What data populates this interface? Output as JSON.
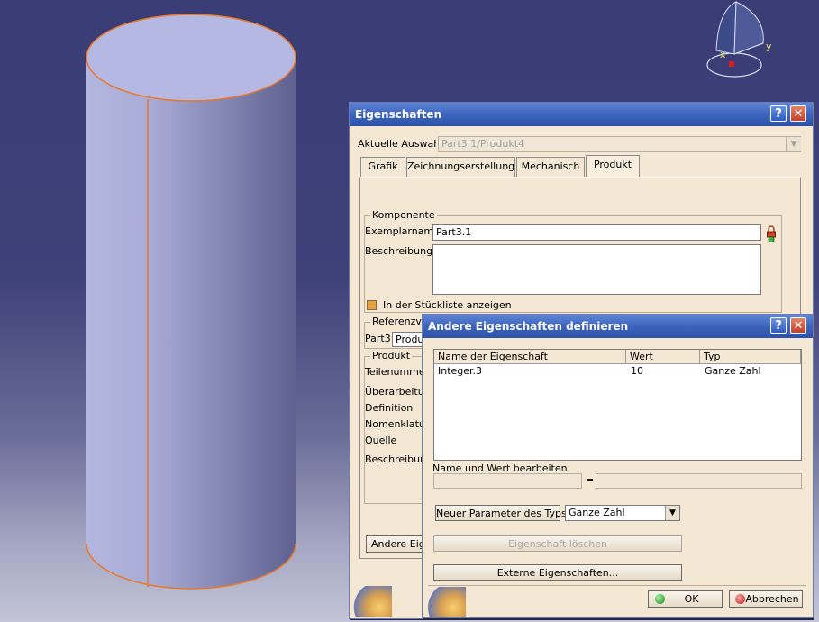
{
  "compass": {
    "y_label": "y",
    "x_label": "x"
  },
  "props": {
    "title": "Eigenschaften",
    "current_label": "Aktuelle Auswahl:",
    "current_value": "Part3.1/Produkt4",
    "tabs": [
      "Grafik",
      "Zeichnungserstellung",
      "Mechanisch",
      "Produkt"
    ],
    "active_tab": "Produkt",
    "komponente": {
      "title": "Komponente",
      "instance_label": "Exemplarname",
      "instance_value": "Part3.1",
      "desc_label": "Beschreibung",
      "bom_label": "In der Stückliste anzeigen"
    },
    "referenz": {
      "title": "Referenzve",
      "row_label": "Part3",
      "row_value": "Produ"
    },
    "produkt": {
      "title": "Produkt",
      "rows": [
        "Teilenummer",
        "Überarbeitun",
        "Definition",
        "Nomenklatur",
        "Quelle",
        "Beschreibung"
      ]
    },
    "other_btn": "Andere Eige"
  },
  "define": {
    "title": "Andere Eigenschaften definieren",
    "columns": [
      "Name der Eigenschaft",
      "Wert",
      "Typ"
    ],
    "rows": [
      {
        "name": "Integer.3",
        "value": "10",
        "type": "Ganze Zahl"
      }
    ],
    "edit_label": "Name und Wert bearbeiten",
    "equals": "=",
    "new_param_btn": "Neuer Parameter des Typs",
    "type_value": "Ganze Zahl",
    "delete_btn": "Eigenschaft löschen",
    "external_btn": "Externe Eigenschaften...",
    "ok_btn": "OK",
    "cancel_btn": "Abbrechen"
  }
}
